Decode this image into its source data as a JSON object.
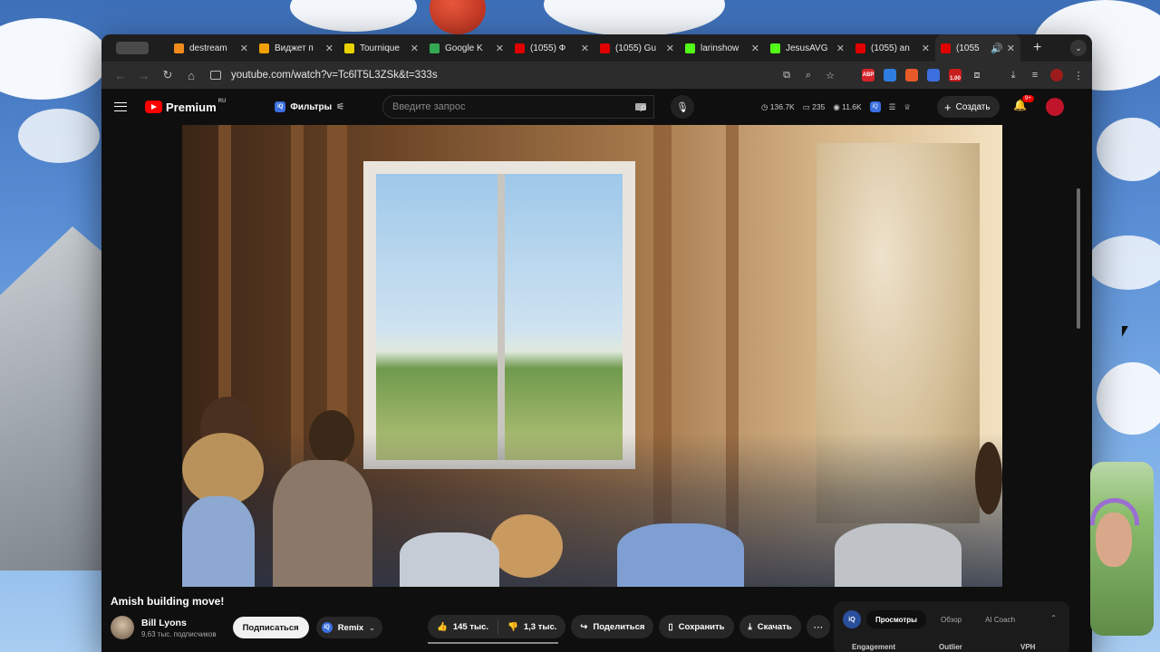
{
  "tabs": [
    {
      "title": "destream",
      "color": "#f08a1c",
      "active": false
    },
    {
      "title": "Виджет п",
      "color": "#f0a000",
      "active": false
    },
    {
      "title": "Tournique",
      "color": "#e9d200",
      "active": false
    },
    {
      "title": "Google K",
      "color": "#34a853",
      "active": false
    },
    {
      "title": "(1055) Ф",
      "color": "#e00000",
      "active": false
    },
    {
      "title": "(1055) Gu",
      "color": "#e00000",
      "active": false
    },
    {
      "title": "larinshow",
      "color": "#53fc18",
      "active": false
    },
    {
      "title": "JesusAVG",
      "color": "#53fc18",
      "active": false
    },
    {
      "title": "(1055) an",
      "color": "#e00000",
      "active": false
    },
    {
      "title": "(1055",
      "color": "#e00000",
      "active": true
    }
  ],
  "address": {
    "url": "youtube.com/watch?v=Tc6lT5L3ZSk&t=333s"
  },
  "extensions": [
    {
      "label": "ABP",
      "color": "#d6232a"
    },
    {
      "label": "",
      "color": "#2f7de1"
    },
    {
      "label": "",
      "color": "#e85a2a"
    },
    {
      "label": "",
      "color": "#3b6fe0"
    },
    {
      "label": "1.00",
      "color": "#c81e1e"
    }
  ],
  "youtube": {
    "logo_text": "Premium",
    "logo_region": "RU",
    "filters_label": "Фильтры",
    "search_placeholder": "Введите запрос",
    "stats": {
      "views": "136.7K",
      "comments": "235",
      "likes": "11.6K"
    },
    "create_label": "Создать",
    "notifications_badge": "9+"
  },
  "video": {
    "title": "Amish building move!",
    "channel": "Bill Lyons",
    "subscribers": "9,63 тыс. подписчиков",
    "subscribe_label": "Подписаться",
    "remix_label": "Remix",
    "likes": "145 тыс.",
    "dislikes": "1,3 тыс.",
    "share_label": "Поделиться",
    "save_label": "Сохранить",
    "download_label": "Скачать"
  },
  "side_panel": {
    "tabs": [
      "Просмотры",
      "Обзор",
      "AI Coach"
    ],
    "active_tab": "Просмотры",
    "columns": [
      "Engagement",
      "Outlier",
      "VPH"
    ]
  }
}
